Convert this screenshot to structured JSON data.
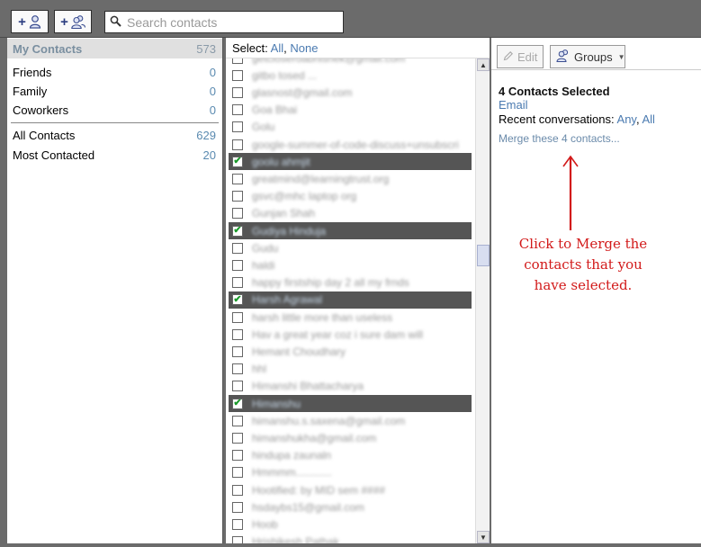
{
  "toolbar": {
    "add_contact_icon": "add-contact-icon",
    "add_group_icon": "add-group-icon",
    "search": {
      "placeholder": "Search contacts"
    }
  },
  "groups": {
    "header": {
      "label": "My Contacts",
      "count": "573"
    },
    "custom": [
      {
        "label": "Friends",
        "count": "0"
      },
      {
        "label": "Family",
        "count": "0"
      },
      {
        "label": "Coworkers",
        "count": "0"
      }
    ],
    "system": [
      {
        "label": "All Contacts",
        "count": "629"
      },
      {
        "label": "Most Contacted",
        "count": "20"
      }
    ]
  },
  "list": {
    "select_label": "Select:",
    "select_all": "All",
    "select_none": "None",
    "rows": [
      {
        "text": "getcloseroabhishek@gmail.com",
        "checked": false
      },
      {
        "text": "gitbo tosed ...",
        "checked": false
      },
      {
        "text": "glasnost@gmail.com",
        "checked": false
      },
      {
        "text": "Goa Bhai",
        "checked": false
      },
      {
        "text": "Golu",
        "checked": false
      },
      {
        "text": "google-summer-of-code-discuss+unsubscri",
        "checked": false
      },
      {
        "text": "goolu ahmjit",
        "checked": true
      },
      {
        "text": "greatmind@learningtrust.org",
        "checked": false
      },
      {
        "text": "gsvc@mhc laptop org",
        "checked": false
      },
      {
        "text": "Gunjan Shah",
        "checked": false
      },
      {
        "text": "Gudiya Hinduja",
        "checked": true
      },
      {
        "text": "Gudu",
        "checked": false
      },
      {
        "text": "haldi",
        "checked": false
      },
      {
        "text": "happy firstship day 2 all my frnds",
        "checked": false
      },
      {
        "text": "Harsh Agrawal",
        "checked": true
      },
      {
        "text": "harsh little more than useless",
        "checked": false
      },
      {
        "text": "Hav a great year coz i sure dam will",
        "checked": false
      },
      {
        "text": "Hemant Choudhary",
        "checked": false
      },
      {
        "text": "hhl",
        "checked": false
      },
      {
        "text": "Himanshi Bhattacharya",
        "checked": false
      },
      {
        "text": "Himanshu",
        "checked": true
      },
      {
        "text": "himanshu.s.saxena@gmail.com",
        "checked": false
      },
      {
        "text": "himanshukha@gmail.com",
        "checked": false
      },
      {
        "text": "hindupa zaunaln",
        "checked": false
      },
      {
        "text": "Hmmmm............",
        "checked": false
      },
      {
        "text": "Hootified: by MID sem ####",
        "checked": false
      },
      {
        "text": "hsdaybs15@gmail.com",
        "checked": false
      },
      {
        "text": "Hoob",
        "checked": false
      },
      {
        "text": "Hrishikesh Pathak",
        "checked": false
      }
    ]
  },
  "detail": {
    "edit_label": "Edit",
    "groups_label": "Groups",
    "title": "4 Contacts Selected",
    "email_link": "Email",
    "recent_label": "Recent conversations:",
    "recent_any": "Any",
    "recent_all": "All",
    "merge_link": "Merge these 4 contacts...",
    "annotation": [
      "Click to Merge the",
      "contacts that you",
      "have selected."
    ]
  },
  "colors": {
    "accent_link": "#4a7ab0",
    "annotation": "#d21a1a",
    "selected_row": "#555555",
    "checkmark": "#1a9a2a"
  }
}
